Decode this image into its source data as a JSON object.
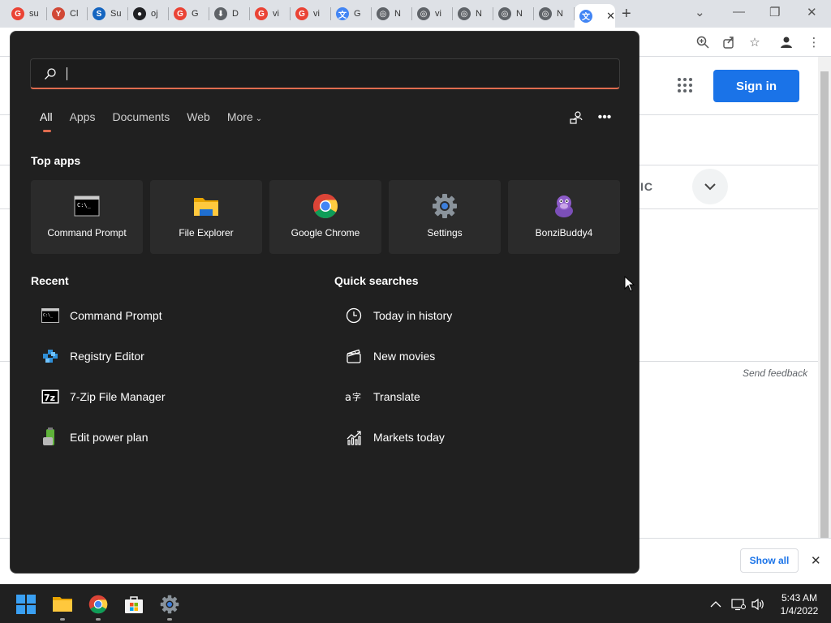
{
  "browser": {
    "tabs": [
      {
        "title": "su",
        "color": "#ea4335",
        "glyph": "G"
      },
      {
        "title": "Cl",
        "color": "#d14836",
        "glyph": "Y"
      },
      {
        "title": "Su",
        "color": "#1565c0",
        "glyph": "S"
      },
      {
        "title": "oj",
        "color": "#202124",
        "glyph": "●"
      },
      {
        "title": "G",
        "color": "#ea4335",
        "glyph": "G"
      },
      {
        "title": "D",
        "color": "#5f6368",
        "glyph": "⬇"
      },
      {
        "title": "vi",
        "color": "#ea4335",
        "glyph": "G"
      },
      {
        "title": "vi",
        "color": "#ea4335",
        "glyph": "G"
      },
      {
        "title": "G",
        "color": "#4285f4",
        "glyph": "文"
      },
      {
        "title": "N",
        "color": "#5f6368",
        "glyph": "◎"
      },
      {
        "title": "vi",
        "color": "#5f6368",
        "glyph": "◎"
      },
      {
        "title": "N",
        "color": "#5f6368",
        "glyph": "◎"
      },
      {
        "title": "N",
        "color": "#5f6368",
        "glyph": "◎"
      },
      {
        "title": "N",
        "color": "#5f6368",
        "glyph": "◎"
      },
      {
        "title": "",
        "color": "#4285f4",
        "glyph": "文"
      }
    ],
    "sign_in_label": "Sign in",
    "translate_label": "IC",
    "send_feedback": "Send feedback",
    "show_all": "Show all"
  },
  "start": {
    "search_placeholder": "",
    "filters": [
      "All",
      "Apps",
      "Documents",
      "Web",
      "More"
    ],
    "top_apps_title": "Top apps",
    "top_apps": [
      {
        "label": "Command Prompt",
        "icon": "cmd-icon"
      },
      {
        "label": "File Explorer",
        "icon": "folder-icon"
      },
      {
        "label": "Google Chrome",
        "icon": "chrome-icon"
      },
      {
        "label": "Settings",
        "icon": "gear-icon"
      },
      {
        "label": "BonziBuddy4",
        "icon": "bonzi-icon"
      }
    ],
    "recent_title": "Recent",
    "recent": [
      {
        "label": "Command Prompt",
        "icon": "cmd-icon"
      },
      {
        "label": "Registry Editor",
        "icon": "registry-icon"
      },
      {
        "label": "7-Zip File Manager",
        "icon": "7zip-icon"
      },
      {
        "label": "Edit power plan",
        "icon": "power-plan-icon"
      }
    ],
    "quick_title": "Quick searches",
    "quick": [
      {
        "label": "Today in history",
        "icon": "clock-icon"
      },
      {
        "label": "New movies",
        "icon": "clapper-icon"
      },
      {
        "label": "Translate",
        "icon": "translate-icon"
      },
      {
        "label": "Markets today",
        "icon": "chart-icon"
      }
    ]
  },
  "taskbar": {
    "time": "5:43 AM",
    "date": "1/4/2022"
  },
  "colors": {
    "accent": "#e06c4f",
    "panel": "#202020",
    "tile": "#2b2b2b",
    "google_blue": "#1a73e8"
  }
}
